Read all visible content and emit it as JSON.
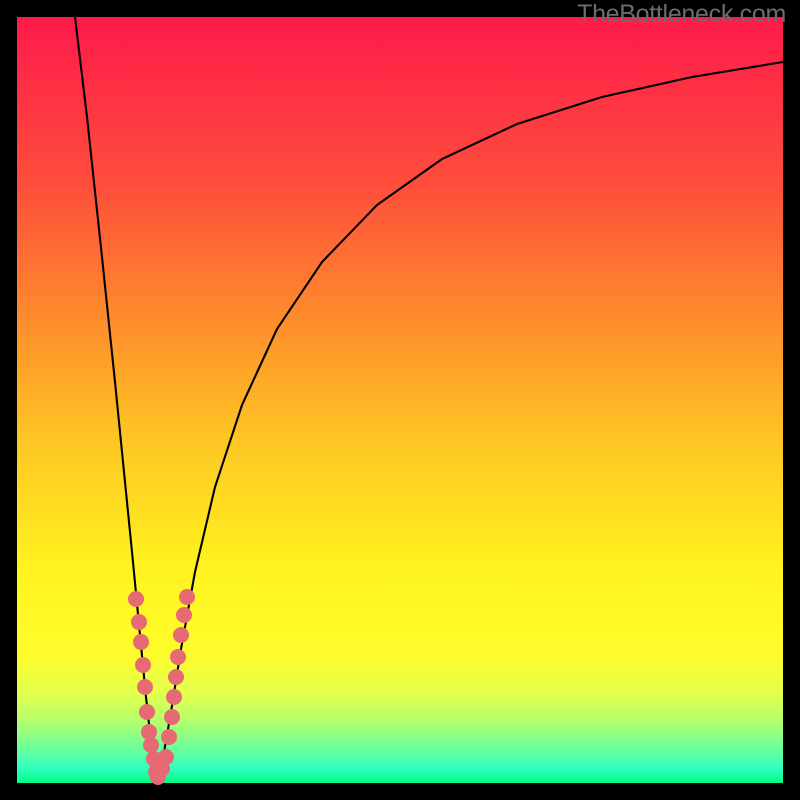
{
  "watermark": "TheBottleneck.com",
  "chart_data": {
    "type": "line",
    "title": "",
    "xlabel": "",
    "ylabel": "",
    "x_range": [
      0,
      766
    ],
    "y_range_value": [
      0,
      100
    ],
    "note": "y axis is inverted visually (low value at bottom = green = good). curve_points are in plot-area pixel coordinates.",
    "vertex_x": 139,
    "curve_points": [
      [
        58,
        0
      ],
      [
        70,
        100
      ],
      [
        85,
        240
      ],
      [
        98,
        365
      ],
      [
        108,
        465
      ],
      [
        116,
        545
      ],
      [
        123,
        618
      ],
      [
        129,
        680
      ],
      [
        134,
        725
      ],
      [
        137,
        750
      ],
      [
        139,
        763
      ],
      [
        142,
        756
      ],
      [
        147,
        735
      ],
      [
        154,
        695
      ],
      [
        164,
        632
      ],
      [
        178,
        555
      ],
      [
        198,
        470
      ],
      [
        225,
        388
      ],
      [
        260,
        312
      ],
      [
        305,
        245
      ],
      [
        360,
        188
      ],
      [
        425,
        142
      ],
      [
        500,
        107
      ],
      [
        585,
        80
      ],
      [
        675,
        60
      ],
      [
        766,
        45
      ]
    ],
    "scatter_dots": [
      [
        119,
        582
      ],
      [
        122,
        605
      ],
      [
        124,
        625
      ],
      [
        126,
        648
      ],
      [
        128,
        670
      ],
      [
        130,
        695
      ],
      [
        132,
        715
      ],
      [
        134,
        728
      ],
      [
        137,
        742
      ],
      [
        139,
        755
      ],
      [
        141,
        760
      ],
      [
        145,
        752
      ],
      [
        149,
        740
      ],
      [
        152,
        720
      ],
      [
        155,
        700
      ],
      [
        157,
        680
      ],
      [
        159,
        660
      ],
      [
        161,
        640
      ],
      [
        164,
        618
      ],
      [
        167,
        598
      ],
      [
        170,
        580
      ]
    ],
    "dot_color": "#e56a73",
    "dot_radius": 8,
    "gradient_stops": [
      {
        "pct": 0,
        "color": "#fe1a4a"
      },
      {
        "pct": 22,
        "color": "#fe4e3b"
      },
      {
        "pct": 40,
        "color": "#fe8e2c"
      },
      {
        "pct": 55,
        "color": "#fec524"
      },
      {
        "pct": 72,
        "color": "#fff31f"
      },
      {
        "pct": 83,
        "color": "#fffc2b"
      },
      {
        "pct": 88,
        "color": "#e5ff4b"
      },
      {
        "pct": 92,
        "color": "#b3ff6d"
      },
      {
        "pct": 95,
        "color": "#74ff93"
      },
      {
        "pct": 98,
        "color": "#33ffc0"
      },
      {
        "pct": 100,
        "color": "#00ff83"
      }
    ]
  }
}
